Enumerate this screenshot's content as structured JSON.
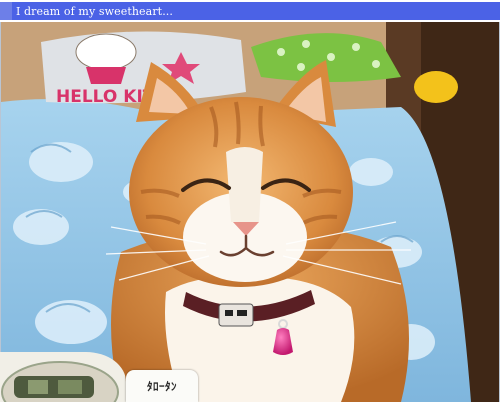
{
  "window": {
    "title": "I dream of my sweetheart..."
  },
  "photo": {
    "subject": "smiling-cat",
    "name_tag": "ﾀﾛｰﾀﾝ",
    "pillow_text": "HELLO KITTY"
  },
  "colors": {
    "title_bar": "#4b62e6",
    "title_accent": "#6d7fe8",
    "title_text": "#ffffff"
  }
}
